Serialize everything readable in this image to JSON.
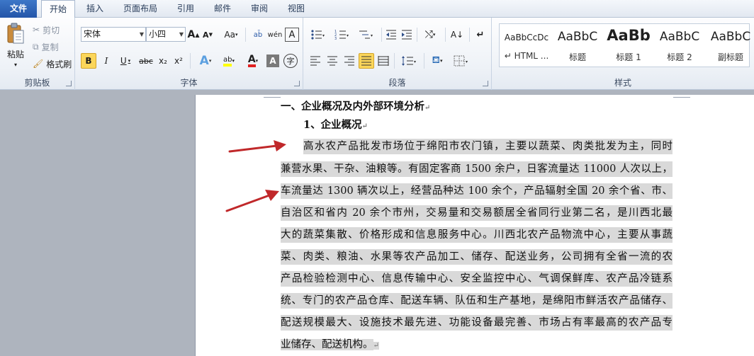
{
  "tabs": [
    {
      "label": "文件"
    },
    {
      "label": "开始"
    },
    {
      "label": "插入"
    },
    {
      "label": "页面布局"
    },
    {
      "label": "引用"
    },
    {
      "label": "邮件"
    },
    {
      "label": "审阅"
    },
    {
      "label": "视图"
    }
  ],
  "clipboard": {
    "group": "剪贴板",
    "paste": "粘贴",
    "cut": "剪切",
    "copy": "复制",
    "format_painter": "格式刷"
  },
  "font": {
    "group": "字体",
    "font_name": "宋体",
    "font_size": "小四",
    "grow": "A",
    "shrink": "A",
    "change_case": "Aa",
    "clear": "A",
    "bold": "B",
    "italic": "I",
    "underline": "U",
    "strike": "abc",
    "subscript": "x₂",
    "superscript": "x²",
    "text_effect": "A",
    "highlight": "ab",
    "font_color": "A",
    "char_shading": "A",
    "enclose": "字"
  },
  "paragraph": {
    "group": "段落"
  },
  "styles": {
    "group": "样式",
    "items": [
      {
        "preview": "AaBbCcDc",
        "name": "↵ HTML ..."
      },
      {
        "preview": "AaBbC",
        "name": "标题"
      },
      {
        "preview": "AaBb",
        "name": "标题 1"
      },
      {
        "preview": "AaBbC",
        "name": "标题 2"
      },
      {
        "preview": "AaBbC",
        "name": "副标题"
      }
    ]
  },
  "document": {
    "heading1": "一、企业概况及内外部环境分析",
    "heading2": "1、企业概况",
    "para_lines": [
      "高水农产品批发市场位于绵阳市农门镇，主要以蔬菜、肉类批发为主，同时",
      "兼营水果、干杂、油粮等。有固定客商 1500 余户，日客流量达 11000 人次以上，",
      "车流量达 1300 辆次以上，经营品种达 100 余个，产品辐射全国 20 余个省、市、",
      "自治区和省内 20 余个市州，交易量和交易额居全省同行业第二名，是川西北最",
      "大的蔬菜集散、价格形成和信息服务中心。川西北农产品物流中心，主要从事蔬",
      "菜、肉类、粮油、水果等农产品加工、储存、配送业务，公司拥有全省一流的农",
      "产品检验检测中心、信息传输中心、安全监控中心、气调保鲜库、农产品冷链系",
      "统、专门的农产品仓库、配送车辆、队伍和生产基地，是绵阳市鲜活农产品储存、",
      "配送规模最大、设施技术最先进、功能设备最完善、市场占有率最高的农产品专",
      "业储存、配送机构。"
    ],
    "para_mark": "↵",
    "highlight_color": "#d9d9d9",
    "arrow_color": "#c0282a"
  }
}
